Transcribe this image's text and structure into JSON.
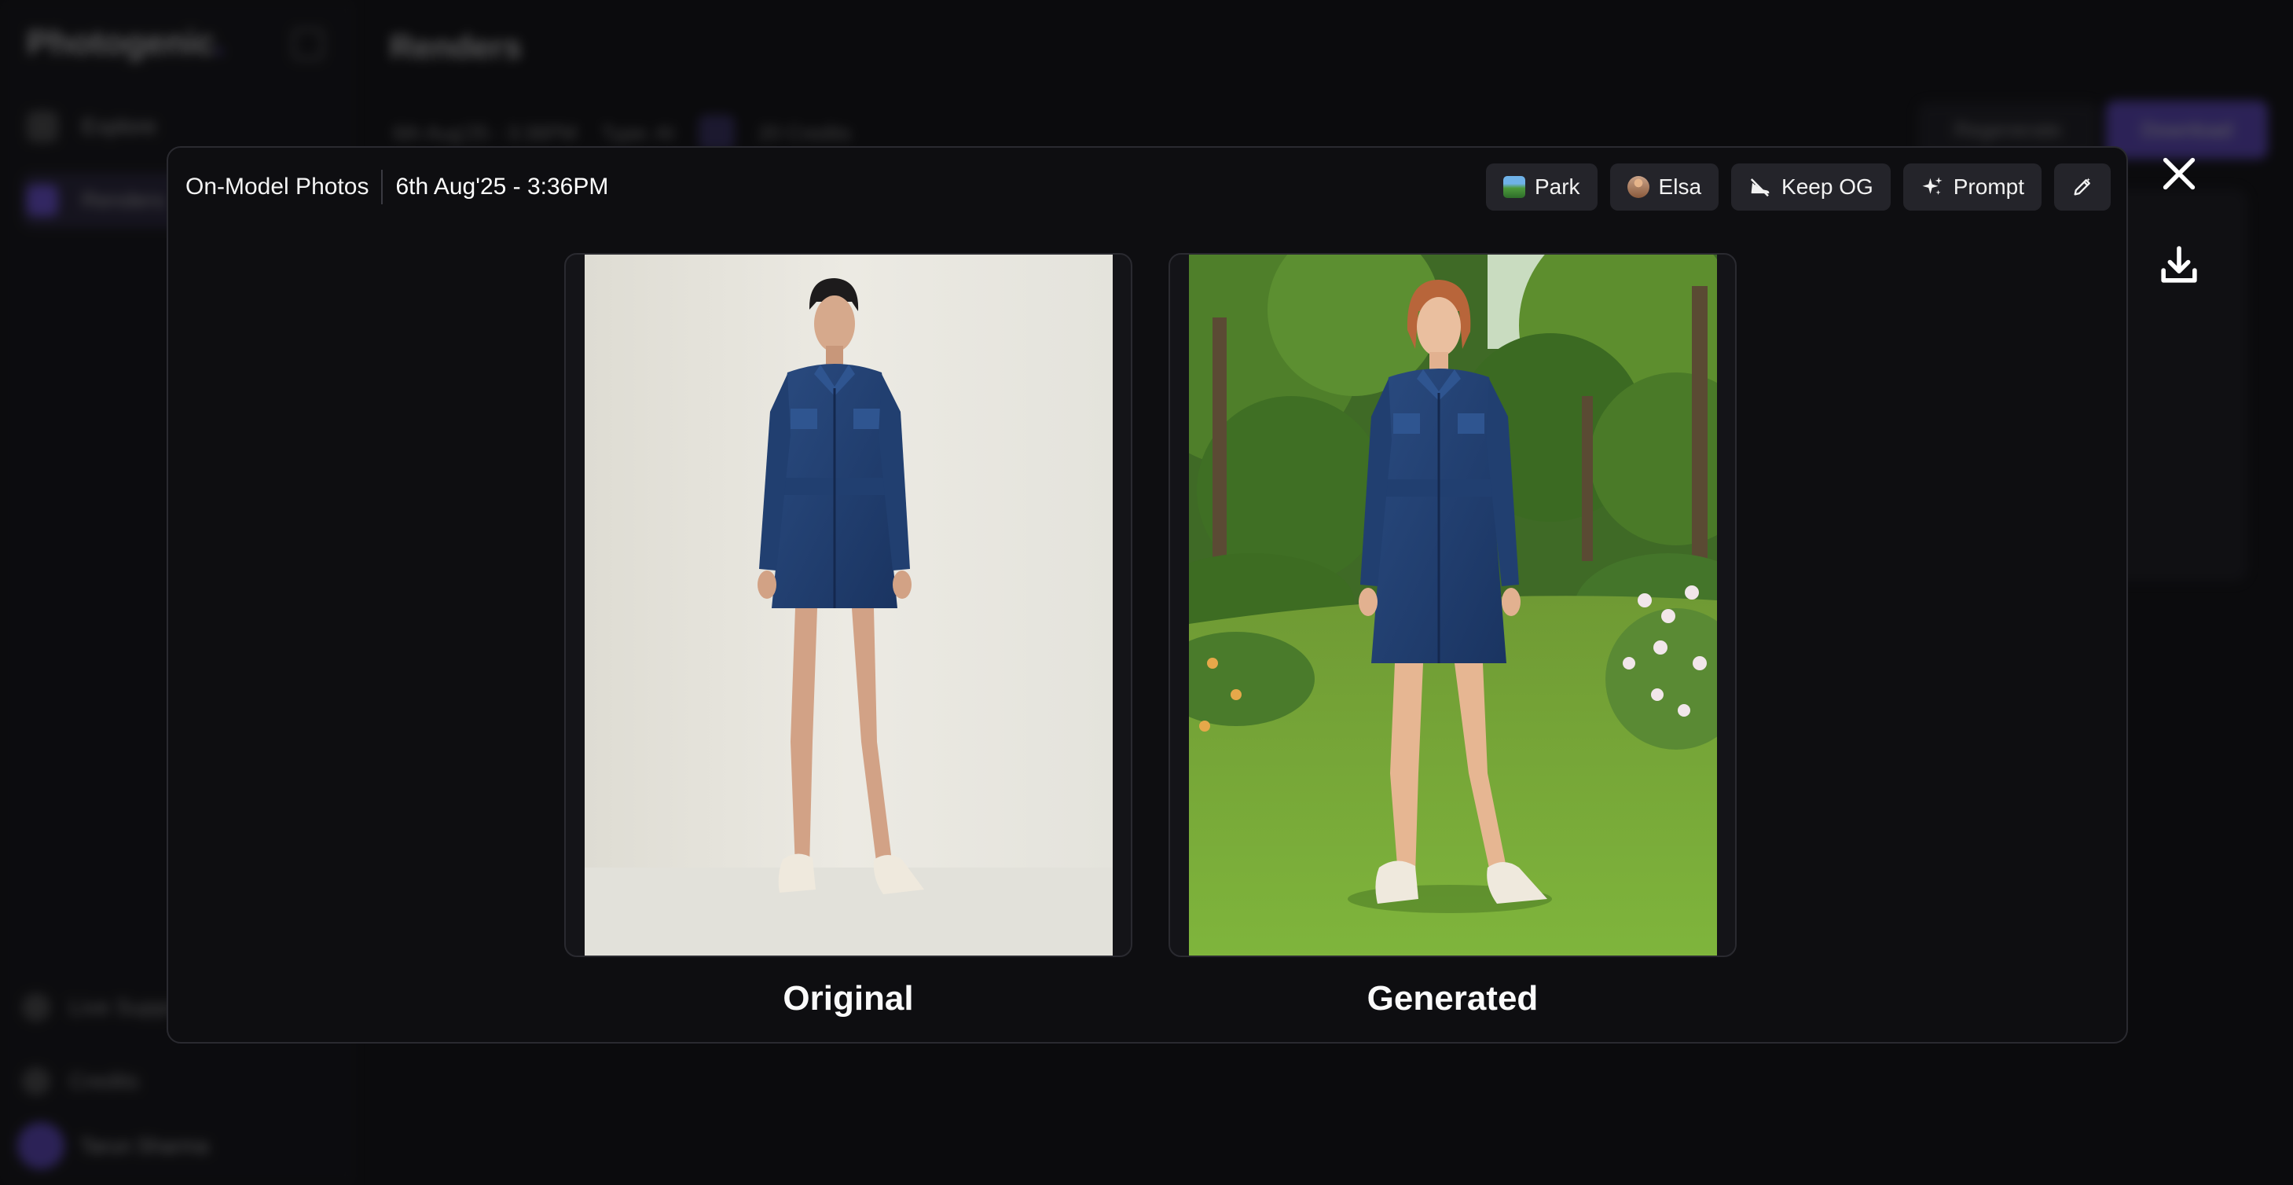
{
  "background": {
    "app_name": "Photogenic",
    "header_title": "Renders",
    "nav_items": [
      {
        "label": "Explore"
      },
      {
        "label": "Renders"
      }
    ],
    "meta": {
      "date": "6th Aug'25 - 3:36PM",
      "type": "Type: AI",
      "credits": "20 Credits"
    },
    "regenerate_label": "Regenerate",
    "download_label": "Download",
    "bottom_links": [
      {
        "label": "Live Support"
      },
      {
        "label": "Credits"
      }
    ],
    "user_name": "Tarun Sharma"
  },
  "modal": {
    "section_title": "On-Model Photos",
    "timestamp": "6th Aug'25 - 3:36PM",
    "tags": [
      {
        "label": "Park",
        "thumb": "park-thumbnail"
      },
      {
        "label": "Elsa",
        "thumb": "model-thumbnail"
      },
      {
        "label": "Keep OG",
        "icon": "shoe-icon"
      },
      {
        "label": "Prompt",
        "icon": "sparkle-icon"
      }
    ],
    "edit_icon": "pencil-icon",
    "panels": [
      {
        "caption": "Original"
      },
      {
        "caption": "Generated"
      }
    ]
  },
  "controls": {
    "close_icon": "close-icon",
    "download_icon": "download-icon"
  },
  "colors": {
    "accent": "#7c5cff",
    "modal_bg": "#0e0e11",
    "chip_bg": "#24242a",
    "dress": "#223f70"
  }
}
